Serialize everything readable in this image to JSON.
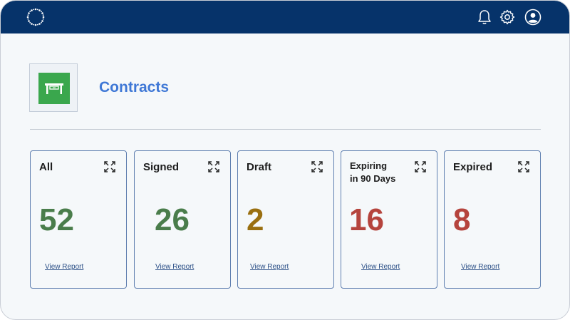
{
  "colors": {
    "topbar": "#06336a",
    "title": "#3f78d6",
    "tile_green": "#3aa74d",
    "green": "#4a7d4b",
    "draft": "#9a6f10",
    "red": "#b5443d"
  },
  "header": {
    "icons": [
      "logo-icon",
      "bell-icon",
      "gear-icon",
      "user-icon"
    ]
  },
  "page": {
    "title": "Contracts",
    "tile_icon": "desk-icon"
  },
  "cards": [
    {
      "title": "All",
      "count": "52",
      "link": "View Report"
    },
    {
      "title": "Signed",
      "count": "26",
      "link": "View Report"
    },
    {
      "title": "Draft",
      "count": "2",
      "link": "View Report"
    },
    {
      "title_line1": "Expiring",
      "title_line2": "in 90 Days",
      "count": "16",
      "link": "View Report"
    },
    {
      "title": "Expired",
      "count": "8",
      "link": "View Report"
    }
  ]
}
